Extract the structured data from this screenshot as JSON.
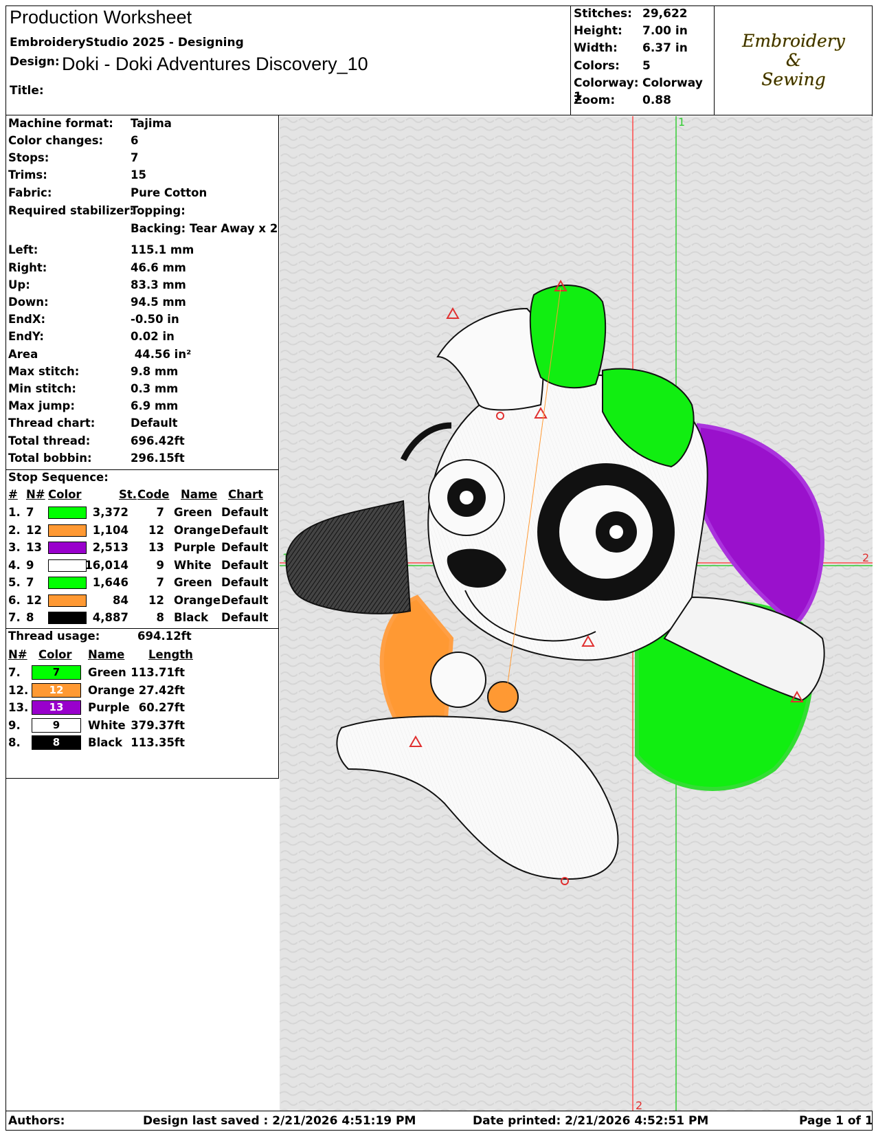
{
  "header": {
    "title": "Production Worksheet",
    "software": "EmbroideryStudio 2025 - Designing",
    "design_label": "Design:",
    "design_name": "Doki - Doki Adventures Discovery_10",
    "title_label": "Title:",
    "title_value": ""
  },
  "stats": [
    {
      "label": "Stitches:",
      "value": "29,622"
    },
    {
      "label": "Height:",
      "value": "7.00 in"
    },
    {
      "label": "Width:",
      "value": "6.37 in"
    },
    {
      "label": "Colors:",
      "value": "5"
    },
    {
      "label": "Colorway:",
      "value": "Colorway 1"
    },
    {
      "label": "Zoom:",
      "value": "0.88"
    }
  ],
  "logo": {
    "line1": "Embroidery",
    "line2": "&",
    "line3": "Sewing"
  },
  "details": [
    {
      "label": "Machine format:",
      "value": "Tajima"
    },
    {
      "label": "Color changes:",
      "value": "6"
    },
    {
      "label": "Stops:",
      "value": "7"
    },
    {
      "label": "Trims:",
      "value": "15"
    },
    {
      "label": "Fabric:",
      "value": "Pure Cotton"
    },
    {
      "label": "Required stabilizer:",
      "value": "Topping:"
    },
    {
      "label": "",
      "value": "Backing: Tear Away x 2"
    },
    {
      "label": "Left:",
      "value": "115.1 mm"
    },
    {
      "label": "Right:",
      "value": "46.6 mm"
    },
    {
      "label": "Up:",
      "value": "83.3 mm"
    },
    {
      "label": "Down:",
      "value": "94.5 mm"
    },
    {
      "label": "EndX:",
      "value": "-0.50 in"
    },
    {
      "label": "EndY:",
      "value": "0.02 in"
    },
    {
      "label": "Area",
      "value": " 44.56 in²"
    },
    {
      "label": "Max stitch:",
      "value": "9.8 mm"
    },
    {
      "label": "Min stitch:",
      "value": "0.3 mm"
    },
    {
      "label": "Max jump:",
      "value": "6.9 mm"
    },
    {
      "label": "Thread chart:",
      "value": "Default"
    },
    {
      "label": "Total thread:",
      "value": "696.42ft"
    },
    {
      "label": "Total bobbin:",
      "value": "296.15ft"
    }
  ],
  "stop_sequence": {
    "title": "Stop Sequence:",
    "headers": {
      "num": "#",
      "n": "N#",
      "color": "Color",
      "st": "St.",
      "code": "Code",
      "name": "Name",
      "chart": "Chart"
    },
    "rows": [
      {
        "num": "1.",
        "n": "7",
        "color": "#00ff00",
        "st": "3,372",
        "code": "7",
        "name": "Green",
        "chart": "Default"
      },
      {
        "num": "2.",
        "n": "12",
        "color": "#ff9933",
        "st": "1,104",
        "code": "12",
        "name": "Orange",
        "chart": "Default"
      },
      {
        "num": "3.",
        "n": "13",
        "color": "#9900cc",
        "st": "2,513",
        "code": "13",
        "name": "Purple",
        "chart": "Default"
      },
      {
        "num": "4.",
        "n": "9",
        "color": "#ffffff",
        "st": "16,014",
        "code": "9",
        "name": "White",
        "chart": "Default"
      },
      {
        "num": "5.",
        "n": "7",
        "color": "#00ff00",
        "st": "1,646",
        "code": "7",
        "name": "Green",
        "chart": "Default"
      },
      {
        "num": "6.",
        "n": "12",
        "color": "#ff9933",
        "st": "84",
        "code": "12",
        "name": "Orange",
        "chart": "Default"
      },
      {
        "num": "7.",
        "n": "8",
        "color": "#000000",
        "st": "4,887",
        "code": "8",
        "name": "Black",
        "chart": "Default"
      }
    ]
  },
  "thread_usage": {
    "title": "Thread usage:",
    "total": "694.12ft",
    "headers": {
      "n": "N#",
      "color": "Color",
      "name": "Name",
      "length": "Length"
    },
    "rows": [
      {
        "n": "7.",
        "code": "7",
        "color": "#00ff00",
        "text_color": "#000000",
        "name": "Green",
        "length": "113.71ft"
      },
      {
        "n": "12.",
        "code": "12",
        "color": "#ff9933",
        "text_color": "#ffffff",
        "name": "Orange",
        "length": "27.42ft"
      },
      {
        "n": "13.",
        "code": "13",
        "color": "#9900cc",
        "text_color": "#ffffff",
        "name": "Purple",
        "length": "60.27ft"
      },
      {
        "n": "9.",
        "code": "9",
        "color": "#ffffff",
        "text_color": "#000000",
        "name": "White",
        "length": "379.37ft"
      },
      {
        "n": "8.",
        "code": "8",
        "color": "#000000",
        "text_color": "#ffffff",
        "name": "Black",
        "length": "113.35ft"
      }
    ]
  },
  "canvas": {
    "axis_marks": {
      "v1": "1",
      "v2": "2",
      "h1": "1",
      "h2": "2"
    }
  },
  "footer": {
    "authors": "Authors:",
    "last_saved": "Design last saved : 2/21/2026 4:51:19 PM",
    "printed": "Date printed: 2/21/2026 4:52:51 PM",
    "page": "Page 1 of 1"
  }
}
